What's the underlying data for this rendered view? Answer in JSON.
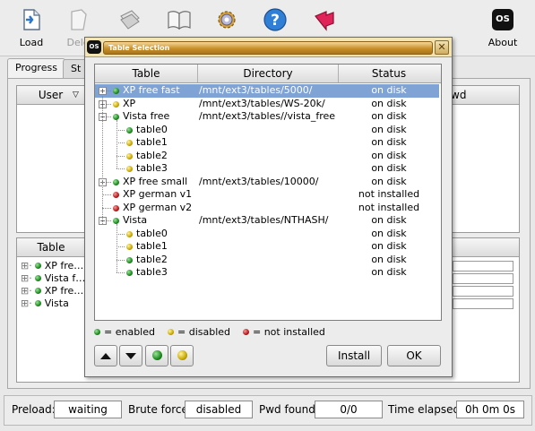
{
  "toolbar": {
    "load": "Load",
    "delete": "Dele",
    "about": "About",
    "os_logo": "OS",
    "icons": [
      "load-icon",
      "delete-icon",
      "save-icon",
      "help-book-icon",
      "settings-gear-icon",
      "help-question-icon",
      "exit-arrow-icon",
      "os-logo-icon"
    ]
  },
  "main": {
    "tabs": [
      "Progress",
      "St"
    ],
    "user_table": {
      "col_user": "User",
      "col_pwd": "wd"
    },
    "tables_panel": {
      "col_table": "Table",
      "rows": [
        "XP fre…",
        "Vista f…",
        "XP fre…",
        "Vista"
      ]
    }
  },
  "statusbar": {
    "preload_label": "Preload:",
    "preload_value": "waiting",
    "bruteforce_label": "Brute force:",
    "bruteforce_value": "disabled",
    "pwdfound_label": "Pwd found:",
    "pwdfound_value": "0/0",
    "elapsed_label": "Time elapsed:",
    "elapsed_value": "0h 0m 0s"
  },
  "dialog": {
    "logo": "OS",
    "title": "Table Selection",
    "close_glyph": "✕",
    "columns": {
      "table": "Table",
      "directory": "Directory",
      "status": "Status"
    },
    "rows": [
      {
        "name": "XP free fast",
        "dir": "/mnt/ext3/tables/5000/",
        "status": "on disk",
        "led": "green",
        "level": 0,
        "expander": "+"
      },
      {
        "name": "XP",
        "dir": "/mnt/ext3/tables/WS-20k/",
        "status": "on disk",
        "led": "yellow",
        "level": 0,
        "expander": "+"
      },
      {
        "name": "Vista free",
        "dir": "/mnt/ext3/tables//vista_free",
        "status": "on disk",
        "led": "green",
        "level": 0,
        "expander": "-"
      },
      {
        "name": "table0",
        "dir": "",
        "status": "on disk",
        "led": "green",
        "level": 1
      },
      {
        "name": "table1",
        "dir": "",
        "status": "on disk",
        "led": "yellow",
        "level": 1
      },
      {
        "name": "table2",
        "dir": "",
        "status": "on disk",
        "led": "yellow",
        "level": 1
      },
      {
        "name": "table3",
        "dir": "",
        "status": "on disk",
        "led": "yellow",
        "level": 1
      },
      {
        "name": "XP free small",
        "dir": "/mnt/ext3/tables/10000/",
        "status": "on disk",
        "led": "green",
        "level": 0,
        "expander": "+"
      },
      {
        "name": "XP german v1",
        "dir": "",
        "status": "not installed",
        "led": "red",
        "level": 0
      },
      {
        "name": "XP german v2",
        "dir": "",
        "status": "not installed",
        "led": "red",
        "level": 0
      },
      {
        "name": "Vista",
        "dir": "/mnt/ext3/tables/NTHASH/",
        "status": "on disk",
        "led": "green",
        "level": 0,
        "expander": "-"
      },
      {
        "name": "table0",
        "dir": "",
        "status": "on disk",
        "led": "yellow",
        "level": 1
      },
      {
        "name": "table1",
        "dir": "",
        "status": "on disk",
        "led": "yellow",
        "level": 1
      },
      {
        "name": "table2",
        "dir": "",
        "status": "on disk",
        "led": "green",
        "level": 1
      },
      {
        "name": "table3",
        "dir": "",
        "status": "on disk",
        "led": "green",
        "level": 1
      }
    ],
    "legend": {
      "enabled": "= enabled",
      "disabled": "= disabled",
      "not_installed": "= not installed"
    },
    "buttons": {
      "install": "Install",
      "ok": "OK"
    }
  },
  "colors": {
    "green": "#1c8a1c",
    "yellow": "#c8a800",
    "red": "#b81818",
    "selection": "#7ea3d4"
  }
}
